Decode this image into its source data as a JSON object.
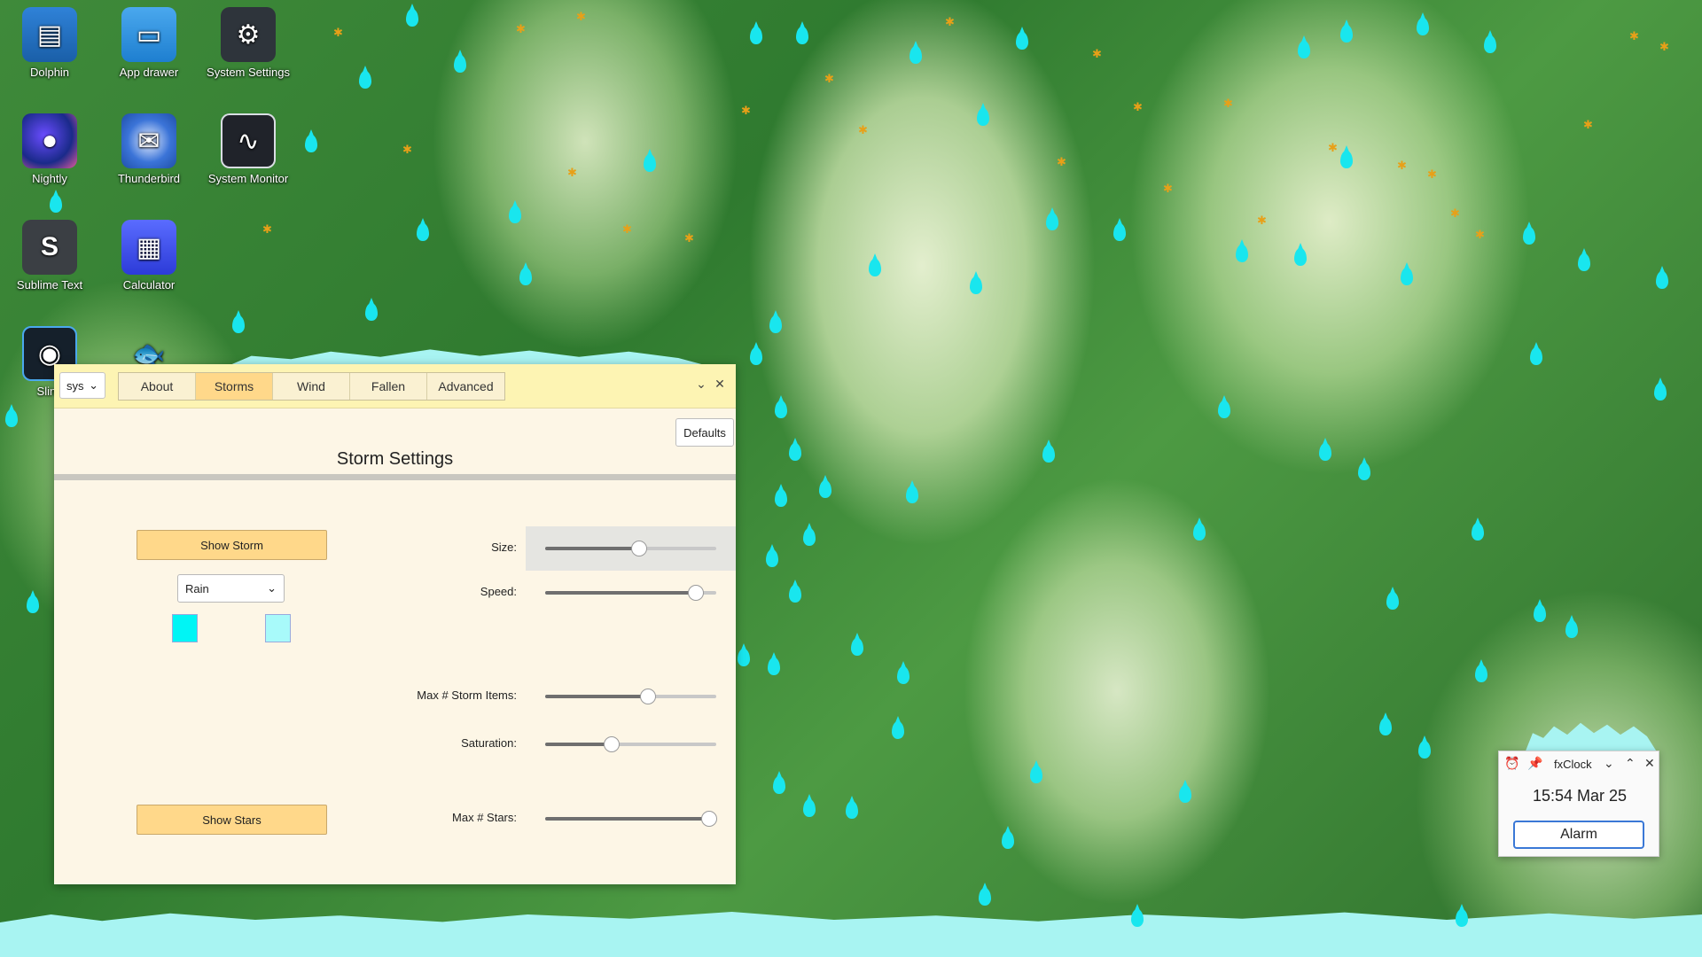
{
  "desktop_icons": [
    {
      "label": "Dolphin",
      "icon": "folder-manager-icon"
    },
    {
      "label": "App drawer",
      "icon": "app-drawer-icon"
    },
    {
      "label": "System Settings",
      "icon": "settings-sliders-icon"
    },
    {
      "label": "Nightly",
      "icon": "nightly-browser-icon"
    },
    {
      "label": "Thunderbird",
      "icon": "thunderbird-mail-icon"
    },
    {
      "label": "System Monitor",
      "icon": "system-monitor-icon"
    },
    {
      "label": "Sublime Text",
      "icon": "sublime-text-icon"
    },
    {
      "label": "Calculator",
      "icon": "calculator-icon"
    },
    {
      "label": "Sling",
      "icon": "sling-app-icon"
    },
    {
      "label": "",
      "icon": "fish-app-icon"
    }
  ],
  "settings_window": {
    "profile_select": "sys",
    "tabs": [
      "About",
      "Storms",
      "Wind",
      "Fallen",
      "Advanced"
    ],
    "active_tab": "Storms",
    "defaults_label": "Defaults",
    "title": "Storm Settings",
    "show_storm_label": "Show Storm",
    "storm_type": "Rain",
    "storm_colors": [
      "#00f5f5",
      "#a8fafa"
    ],
    "show_stars_label": "Show Stars",
    "sliders": [
      {
        "label": "Size:",
        "value": 0.55
      },
      {
        "label": "Speed:",
        "value": 0.88
      },
      {
        "label": "Max # Storm Items:",
        "value": 0.6
      },
      {
        "label": "Saturation:",
        "value": 0.39
      },
      {
        "label": "Max # Stars:",
        "value": 0.96
      }
    ]
  },
  "clock_widget": {
    "title": "fxClock",
    "time": "15:54 Mar 25",
    "alarm_label": "Alarm"
  },
  "colors": {
    "rain": "#19e6ee",
    "accent_button": "#ffd88a",
    "window_header": "#fdf4b3"
  }
}
